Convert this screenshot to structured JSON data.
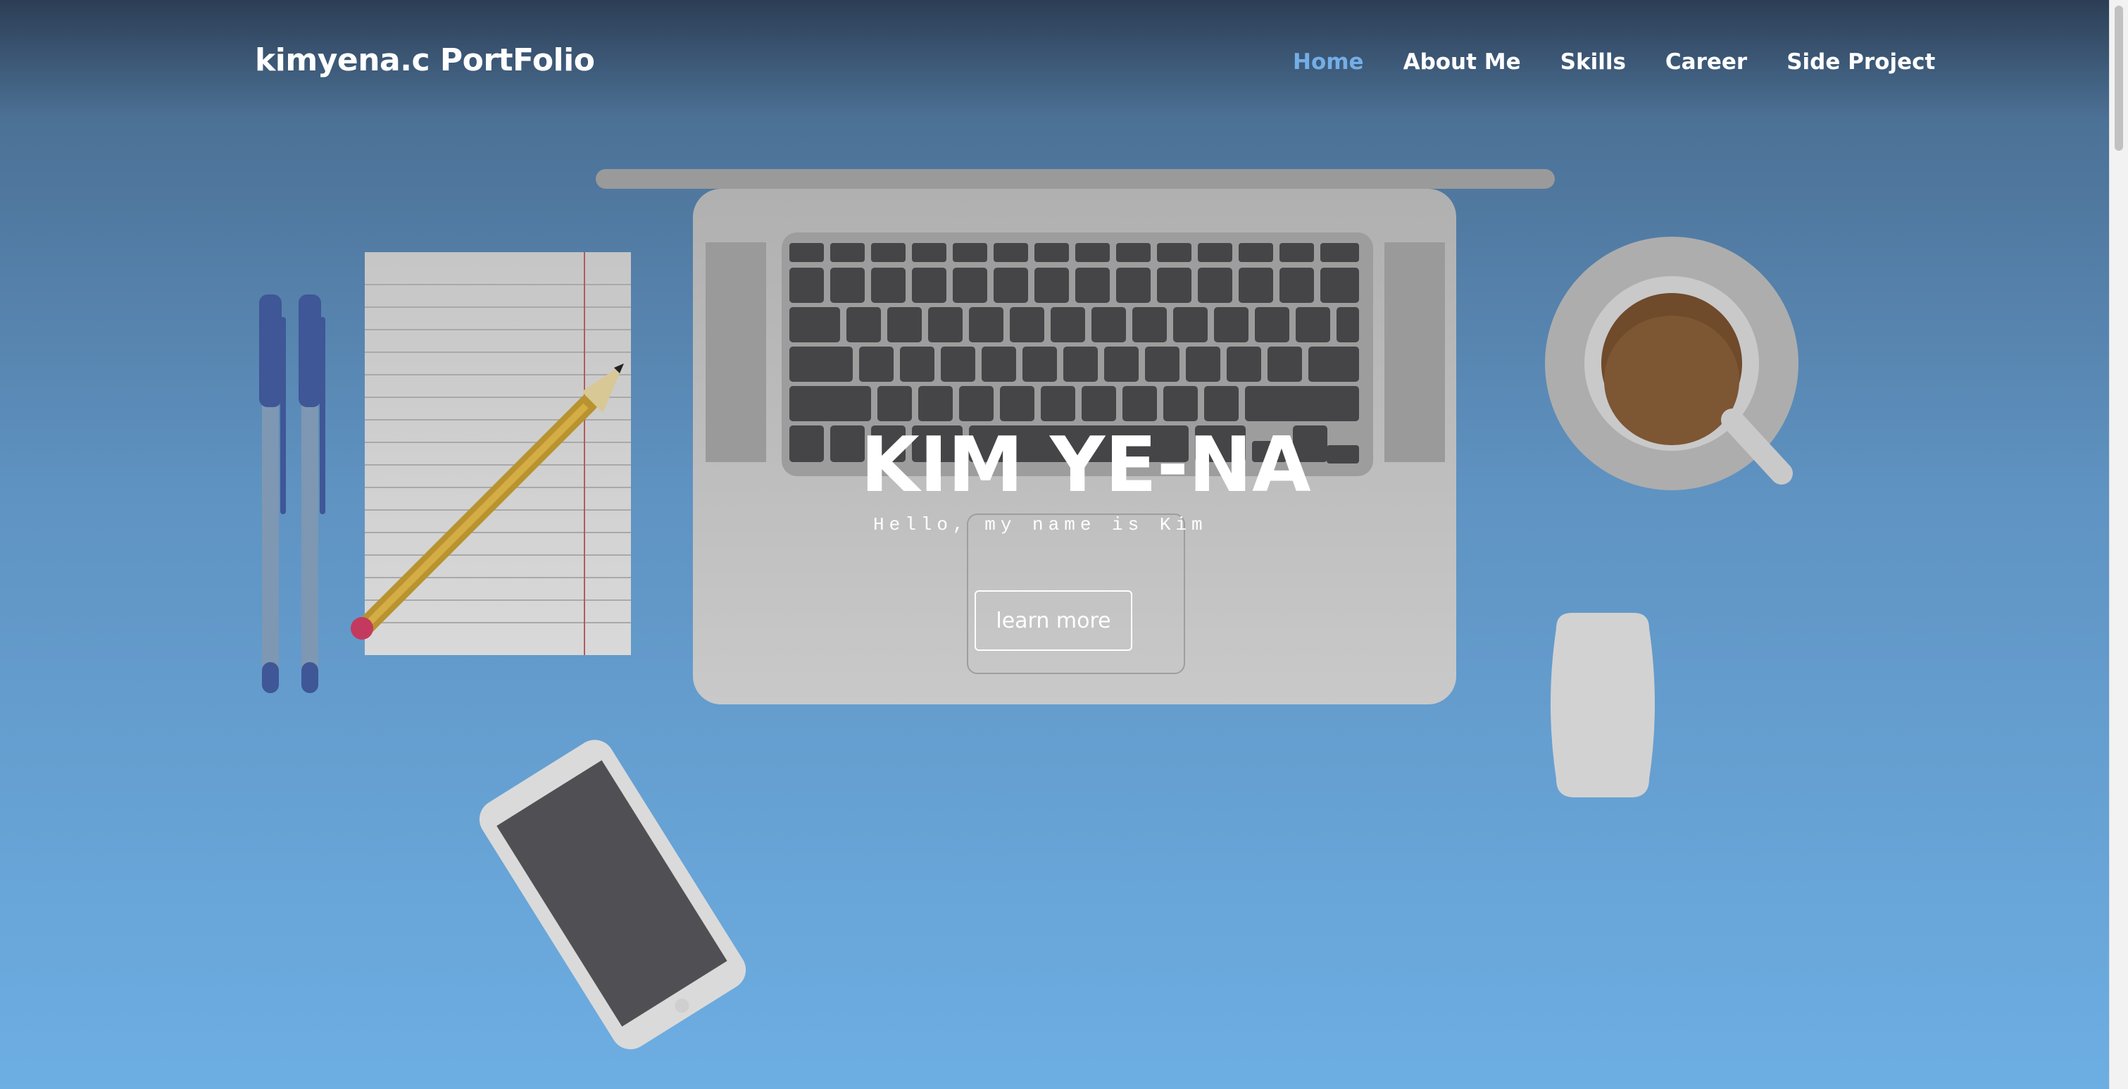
{
  "header": {
    "brand": "kimyena.c PortFolio"
  },
  "nav": {
    "items": [
      {
        "label": "Home",
        "active": true
      },
      {
        "label": "About Me",
        "active": false
      },
      {
        "label": "Skills",
        "active": false
      },
      {
        "label": "Career",
        "active": false
      },
      {
        "label": "Side Project",
        "active": false
      }
    ]
  },
  "hero": {
    "title": "KIM YE-NA",
    "subtitle": "Hello, my name is Kim",
    "button_label": "learn more"
  },
  "colors": {
    "nav_active": "#74aee6",
    "text": "#ffffff",
    "background_top": "#2c3e55",
    "background_bottom": "#6daee3"
  }
}
